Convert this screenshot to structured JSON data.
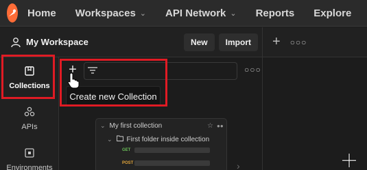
{
  "topnav": {
    "logo_icon": "postman-logo-icon",
    "items": [
      {
        "label": "Home",
        "dropdown": false
      },
      {
        "label": "Workspaces",
        "dropdown": true
      },
      {
        "label": "API Network",
        "dropdown": true
      },
      {
        "label": "Reports",
        "dropdown": false
      },
      {
        "label": "Explore",
        "dropdown": false
      }
    ]
  },
  "workspace": {
    "title": "My Workspace",
    "new_label": "New",
    "import_label": "Import",
    "user_icon": "user-icon"
  },
  "tabs_area": {
    "add_icon": "plus-icon",
    "more_icon": "more-horizontal-icon"
  },
  "sidebar": {
    "items": [
      {
        "label": "Collections",
        "icon": "collections-icon",
        "active": true
      },
      {
        "label": "APIs",
        "icon": "apis-icon",
        "active": false
      },
      {
        "label": "Environments",
        "icon": "environments-icon",
        "active": false
      }
    ]
  },
  "collections_panel": {
    "add_icon": "plus-icon",
    "filter_icon": "filter-icon",
    "more_icon": "more-horizontal-icon",
    "tooltip": "Create new Collection"
  },
  "preview_card": {
    "collection_name": "My first collection",
    "folder_name": "First folder inside collection",
    "requests": [
      {
        "method": "GET"
      },
      {
        "method": "POST"
      }
    ]
  },
  "colors": {
    "accent": "#ff6c37",
    "highlight_box": "#e01b24",
    "background": "#1c1c1c",
    "get": "#6bbf59",
    "post": "#e3a63b"
  }
}
